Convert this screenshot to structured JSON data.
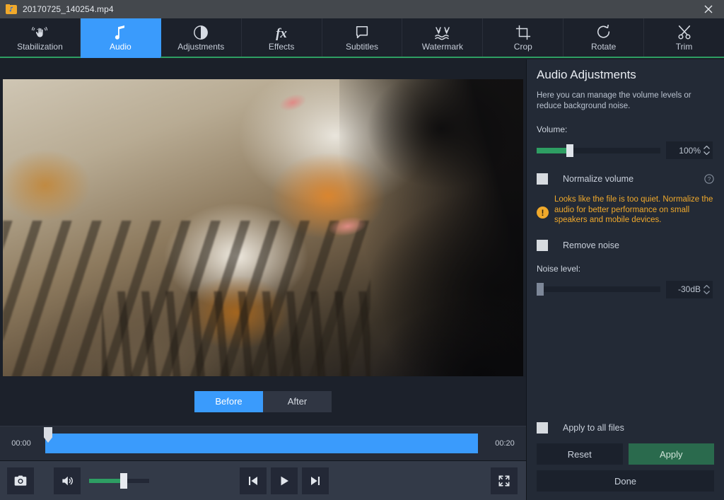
{
  "window": {
    "title": "20170725_140254.mp4",
    "app_icon": "video-file-icon",
    "close_label": "×"
  },
  "tabs": [
    {
      "label": "Stabilization",
      "icon": "hand-shake-icon",
      "active": false
    },
    {
      "label": "Audio",
      "icon": "music-note-icon",
      "active": true
    },
    {
      "label": "Adjustments",
      "icon": "contrast-circle-icon",
      "active": false
    },
    {
      "label": "Effects",
      "icon": "fx-icon",
      "active": false
    },
    {
      "label": "Subtitles",
      "icon": "speech-bubble-icon",
      "active": false
    },
    {
      "label": "Watermark",
      "icon": "watermark-icon",
      "active": false
    },
    {
      "label": "Crop",
      "icon": "crop-icon",
      "active": false
    },
    {
      "label": "Rotate",
      "icon": "rotate-icon",
      "active": false
    },
    {
      "label": "Trim",
      "icon": "scissors-icon",
      "active": false
    }
  ],
  "preview": {
    "compare": {
      "before_label": "Before",
      "after_label": "After",
      "selected": "Before"
    },
    "timeline": {
      "start_time": "00:00",
      "end_time": "00:20",
      "progress_percent": 99
    },
    "controls": {
      "snapshot_icon": "camera-icon",
      "volume_icon": "speaker-icon",
      "volume_percent": 55,
      "prev_icon": "skip-previous-icon",
      "play_icon": "play-icon",
      "next_icon": "skip-next-icon",
      "fullscreen_icon": "fullscreen-icon"
    }
  },
  "panel": {
    "title": "Audio Adjustments",
    "description": "Here you can manage the volume levels or reduce background noise.",
    "volume": {
      "label": "Volume:",
      "value": "100%",
      "slider_percent": 25
    },
    "normalize": {
      "label": "Normalize volume",
      "checked": false,
      "help_icon": "question-mark-icon"
    },
    "warning": {
      "icon": "warning-exclamation-icon",
      "text": "Looks like the file is too quiet. Normalize the audio for better performance on small speakers and mobile devices.",
      "color": "#f0a92b"
    },
    "remove_noise": {
      "label": "Remove noise",
      "checked": false
    },
    "noise_level": {
      "label": "Noise level:",
      "value": "-30dB",
      "slider_percent": 0,
      "disabled": true
    },
    "apply_all": {
      "label": "Apply to all files",
      "checked": false
    },
    "buttons": {
      "reset": "Reset",
      "apply": "Apply",
      "done": "Done"
    }
  },
  "colors": {
    "accent_blue": "#3a9bfc",
    "accent_green": "#2e9e63",
    "warning_orange": "#f0a92b",
    "panel_bg": "#232a36",
    "window_bg": "#1b2029"
  }
}
